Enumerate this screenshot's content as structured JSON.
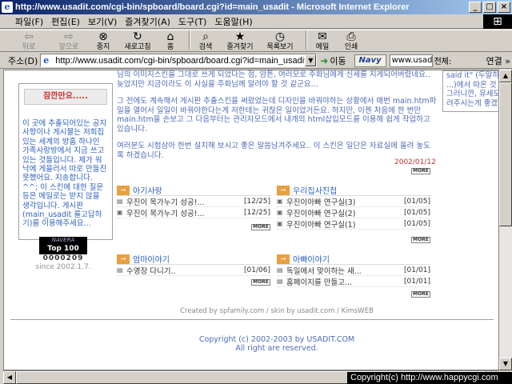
{
  "window": {
    "title": "http://www.usadit.com/cgi-bin/spboard/board.cgi?id=main_usadit - Microsoft Internet Explorer"
  },
  "menu": [
    "파일(F)",
    "편집(E)",
    "보기(V)",
    "즐겨찾기(A)",
    "도구(T)",
    "도움말(H)"
  ],
  "toolbar": {
    "back": "뒤로",
    "forward": "앞으로",
    "stop": "중지",
    "refresh": "새로고침",
    "home": "홈",
    "search": "검색",
    "favorites": "즐겨찾기",
    "history": "목록보기",
    "mail": "메일",
    "print": "인쇄"
  },
  "address": {
    "label": "주소(D)",
    "url": "http://www.usadit.com/cgi-bin/spboard/board.cgi?id=main_usadit",
    "go": "이동",
    "naver": "Navy",
    "search_value": "www.usad..",
    "search_scope": "전체:",
    "links": "연결 »"
  },
  "notice": {
    "title": "잠깐만요.....",
    "body": "이 곳에 추출되어있는 공지사항이나 게시물는 저희집있는 세계의 방홈 하나인 가족사랑방에서 지금 쓰고 있는 것들입니다. 제가 워낙에 게을러서 따로 만들진 못했어요. 지송합니다. ^^; 이 스킨에 대한 질문등은 메일로는 받지 않을 생각입니다. 게시판(main_usadit 를고답하기)를 이용해주세요..."
  },
  "nv_rank": {
    "line1": "NAVERA",
    "line2": "Top 100"
  },
  "visitor_count": "0000209",
  "since": "since 2002.1.7.",
  "main_text": {
    "p1": "님의 이미지스킨을 그대로 쓰게 되었다는 점, 암튼, 여러모로 주화님에게 신세를 지게되어버렸네요.. 늦었지만 지금이라도 이 사실을 주화님께 알려야 할 것 같군요...",
    "p2": "그 전에도 계속해서 게시판 추출스킨을 써왔었는데 디자인을 바꿔야하는 상황에서 매번 main.htm파일을 열어서 일일이 바꿔야한다는게 저한테는 귀찮은 일이었거든요. 하지만, 이젠 처음에 한 번만 main.htm을 손보고 그 다음부터는 관리자모드에서 내개의 html삽입모드를 이용해 쉽게 작업하고 있습니다.",
    "p3": "여러분도 시험삼아 한번 설치해 보시고 좋은 말씀남겨주세요.. 이 스킨은 일단은 자료실에 올려 놓도록 하겠습니다.",
    "date": "2002/01/12"
  },
  "right_sliver": [
    "said it\" (두말하면)",
    "...)에서 따온 것",
    "그러니깐, 유세도",
    "려주시는게 좋겠"
  ],
  "boards": [
    {
      "name": "아기사랑",
      "tag": "→",
      "rows": [
        {
          "title": "우진이 목가누기 성공!...",
          "date": "[12/25]"
        },
        {
          "title": "우진이 목가누기 성공!...",
          "date": "[12/25]"
        }
      ]
    },
    {
      "name": "우리집사진첩",
      "tag": "→",
      "rows": [
        {
          "title": "우진이아빠 연구실(3)",
          "date": "[01/05]"
        },
        {
          "title": "우진이아빠 연구실(2)",
          "date": "[01/05]"
        },
        {
          "title": "우진이아빠 연구실(1)",
          "date": "[01/05]"
        }
      ]
    },
    {
      "name": "엄마이야기",
      "tag": "→",
      "rows": [
        {
          "title": "수영장 다니기..",
          "date": "[01/06]"
        }
      ]
    },
    {
      "name": "아빠이야기",
      "tag": "→",
      "rows": [
        {
          "title": "독일에서 맞이하는 새...",
          "date": "[01/01]"
        },
        {
          "title": "홈페이지를 만들고...",
          "date": "[01/01]"
        }
      ]
    }
  ],
  "more_label": "MORE",
  "credits": "Created by spfamily.com / skin by usadit.com / KimsWEB",
  "copyright": {
    "line1": "Copyright (c) 2002-2003 by USADIT.COM",
    "line2": "All right are reserved."
  },
  "status_overlay": "Copyright(c) http://www.happycgi.com"
}
